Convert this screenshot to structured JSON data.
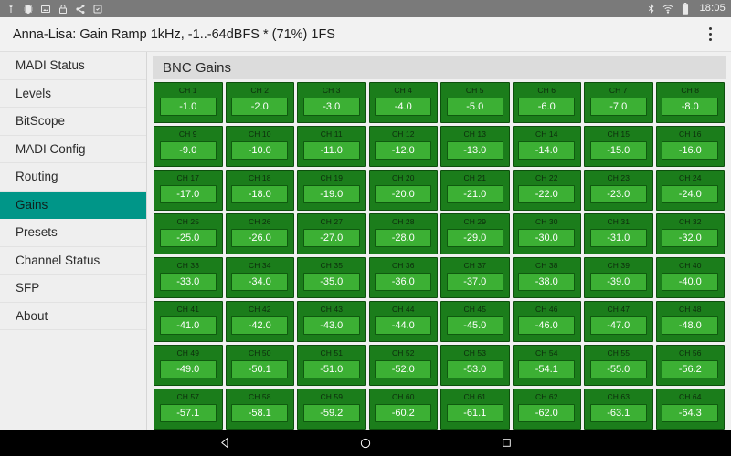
{
  "status_bar": {
    "left_icons": [
      {
        "name": "usb-icon"
      },
      {
        "name": "bug-report-icon"
      },
      {
        "name": "screenshot-icon"
      },
      {
        "name": "lock-icon"
      },
      {
        "name": "share-network-icon"
      },
      {
        "name": "app-install-icon"
      }
    ],
    "right_icons": [
      {
        "name": "bluetooth-icon"
      },
      {
        "name": "wifi-icon"
      },
      {
        "name": "battery-icon"
      }
    ],
    "clock": "18:05"
  },
  "app_bar": {
    "title": "Anna-Lisa: Gain Ramp 1kHz, -1..-64dBFS * (71%) 1FS",
    "overflow_icon": "more-vert-icon"
  },
  "sidebar": {
    "selected": "Gains",
    "items": [
      {
        "label": "MADI Status"
      },
      {
        "label": "Levels"
      },
      {
        "label": "BitScope"
      },
      {
        "label": "MADI Config"
      },
      {
        "label": "Routing"
      },
      {
        "label": "Gains"
      },
      {
        "label": "Presets"
      },
      {
        "label": "Channel Status"
      },
      {
        "label": "SFP"
      },
      {
        "label": "About"
      }
    ]
  },
  "main": {
    "panel_title": "BNC Gains",
    "colors": {
      "cell_background": "#1b7d1b",
      "cell_border": "#0d4f0d",
      "value_background": "#3cb034",
      "accent_teal": "#009688"
    },
    "channels": [
      {
        "label": "CH 1",
        "value": "-1.0"
      },
      {
        "label": "CH 2",
        "value": "-2.0"
      },
      {
        "label": "CH 3",
        "value": "-3.0"
      },
      {
        "label": "CH 4",
        "value": "-4.0"
      },
      {
        "label": "CH 5",
        "value": "-5.0"
      },
      {
        "label": "CH 6",
        "value": "-6.0"
      },
      {
        "label": "CH 7",
        "value": "-7.0"
      },
      {
        "label": "CH 8",
        "value": "-8.0"
      },
      {
        "label": "CH 9",
        "value": "-9.0"
      },
      {
        "label": "CH 10",
        "value": "-10.0"
      },
      {
        "label": "CH 11",
        "value": "-11.0"
      },
      {
        "label": "CH 12",
        "value": "-12.0"
      },
      {
        "label": "CH 13",
        "value": "-13.0"
      },
      {
        "label": "CH 14",
        "value": "-14.0"
      },
      {
        "label": "CH 15",
        "value": "-15.0"
      },
      {
        "label": "CH 16",
        "value": "-16.0"
      },
      {
        "label": "CH 17",
        "value": "-17.0"
      },
      {
        "label": "CH 18",
        "value": "-18.0"
      },
      {
        "label": "CH 19",
        "value": "-19.0"
      },
      {
        "label": "CH 20",
        "value": "-20.0"
      },
      {
        "label": "CH 21",
        "value": "-21.0"
      },
      {
        "label": "CH 22",
        "value": "-22.0"
      },
      {
        "label": "CH 23",
        "value": "-23.0"
      },
      {
        "label": "CH 24",
        "value": "-24.0"
      },
      {
        "label": "CH 25",
        "value": "-25.0"
      },
      {
        "label": "CH 26",
        "value": "-26.0"
      },
      {
        "label": "CH 27",
        "value": "-27.0"
      },
      {
        "label": "CH 28",
        "value": "-28.0"
      },
      {
        "label": "CH 29",
        "value": "-29.0"
      },
      {
        "label": "CH 30",
        "value": "-30.0"
      },
      {
        "label": "CH 31",
        "value": "-31.0"
      },
      {
        "label": "CH 32",
        "value": "-32.0"
      },
      {
        "label": "CH 33",
        "value": "-33.0"
      },
      {
        "label": "CH 34",
        "value": "-34.0"
      },
      {
        "label": "CH 35",
        "value": "-35.0"
      },
      {
        "label": "CH 36",
        "value": "-36.0"
      },
      {
        "label": "CH 37",
        "value": "-37.0"
      },
      {
        "label": "CH 38",
        "value": "-38.0"
      },
      {
        "label": "CH 39",
        "value": "-39.0"
      },
      {
        "label": "CH 40",
        "value": "-40.0"
      },
      {
        "label": "CH 41",
        "value": "-41.0"
      },
      {
        "label": "CH 42",
        "value": "-42.0"
      },
      {
        "label": "CH 43",
        "value": "-43.0"
      },
      {
        "label": "CH 44",
        "value": "-44.0"
      },
      {
        "label": "CH 45",
        "value": "-45.0"
      },
      {
        "label": "CH 46",
        "value": "-46.0"
      },
      {
        "label": "CH 47",
        "value": "-47.0"
      },
      {
        "label": "CH 48",
        "value": "-48.0"
      },
      {
        "label": "CH 49",
        "value": "-49.0"
      },
      {
        "label": "CH 50",
        "value": "-50.1"
      },
      {
        "label": "CH 51",
        "value": "-51.0"
      },
      {
        "label": "CH 52",
        "value": "-52.0"
      },
      {
        "label": "CH 53",
        "value": "-53.0"
      },
      {
        "label": "CH 54",
        "value": "-54.1"
      },
      {
        "label": "CH 55",
        "value": "-55.0"
      },
      {
        "label": "CH 56",
        "value": "-56.2"
      },
      {
        "label": "CH 57",
        "value": "-57.1"
      },
      {
        "label": "CH 58",
        "value": "-58.1"
      },
      {
        "label": "CH 59",
        "value": "-59.2"
      },
      {
        "label": "CH 60",
        "value": "-60.2"
      },
      {
        "label": "CH 61",
        "value": "-61.1"
      },
      {
        "label": "CH 62",
        "value": "-62.0"
      },
      {
        "label": "CH 63",
        "value": "-63.1"
      },
      {
        "label": "CH 64",
        "value": "-64.3"
      }
    ]
  },
  "nav_bar": {
    "buttons": [
      {
        "name": "back-icon"
      },
      {
        "name": "home-icon"
      },
      {
        "name": "recents-icon"
      }
    ]
  }
}
